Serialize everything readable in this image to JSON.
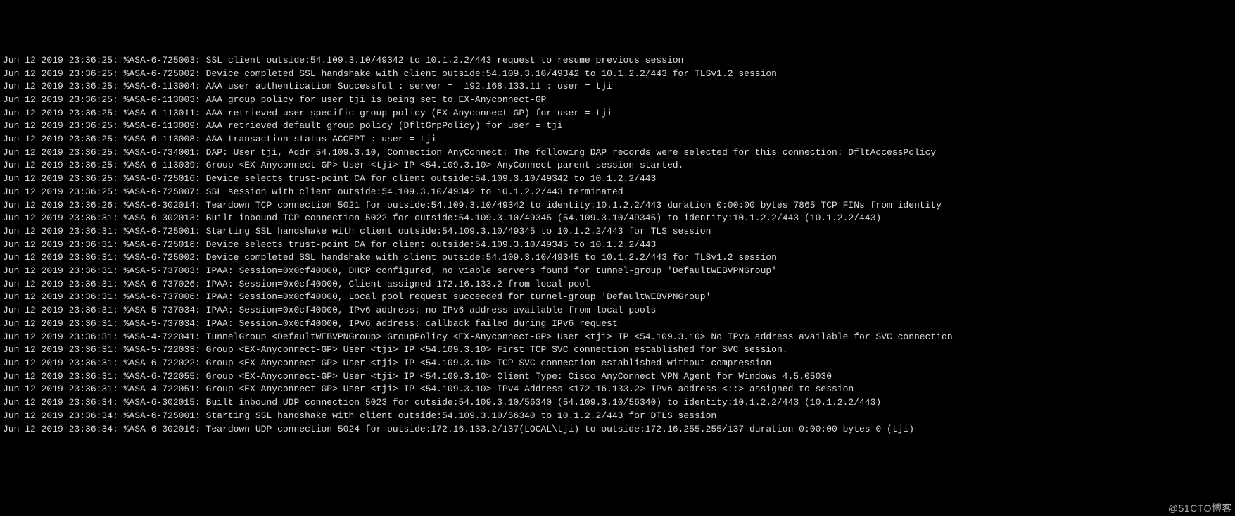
{
  "logs": [
    "Jun 12 2019 23:36:25: %ASA-6-725003: SSL client outside:54.109.3.10/49342 to 10.1.2.2/443 request to resume previous session",
    "Jun 12 2019 23:36:25: %ASA-6-725002: Device completed SSL handshake with client outside:54.109.3.10/49342 to 10.1.2.2/443 for TLSv1.2 session",
    "Jun 12 2019 23:36:25: %ASA-6-113004: AAA user authentication Successful : server =  192.168.133.11 : user = tji",
    "Jun 12 2019 23:36:25: %ASA-6-113003: AAA group policy for user tji is being set to EX-Anyconnect-GP",
    "Jun 12 2019 23:36:25: %ASA-6-113011: AAA retrieved user specific group policy (EX-Anyconnect-GP) for user = tji",
    "Jun 12 2019 23:36:25: %ASA-6-113009: AAA retrieved default group policy (DfltGrpPolicy) for user = tji",
    "Jun 12 2019 23:36:25: %ASA-6-113008: AAA transaction status ACCEPT : user = tji",
    "Jun 12 2019 23:36:25: %ASA-6-734001: DAP: User tji, Addr 54.109.3.10, Connection AnyConnect: The following DAP records were selected for this connection: DfltAccessPolicy",
    "Jun 12 2019 23:36:25: %ASA-6-113039: Group <EX-Anyconnect-GP> User <tji> IP <54.109.3.10> AnyConnect parent session started.",
    "Jun 12 2019 23:36:25: %ASA-6-725016: Device selects trust-point CA for client outside:54.109.3.10/49342 to 10.1.2.2/443",
    "Jun 12 2019 23:36:25: %ASA-6-725007: SSL session with client outside:54.109.3.10/49342 to 10.1.2.2/443 terminated",
    "Jun 12 2019 23:36:26: %ASA-6-302014: Teardown TCP connection 5021 for outside:54.109.3.10/49342 to identity:10.1.2.2/443 duration 0:00:00 bytes 7865 TCP FINs from identity",
    "Jun 12 2019 23:36:31: %ASA-6-302013: Built inbound TCP connection 5022 for outside:54.109.3.10/49345 (54.109.3.10/49345) to identity:10.1.2.2/443 (10.1.2.2/443)",
    "Jun 12 2019 23:36:31: %ASA-6-725001: Starting SSL handshake with client outside:54.109.3.10/49345 to 10.1.2.2/443 for TLS session",
    "Jun 12 2019 23:36:31: %ASA-6-725016: Device selects trust-point CA for client outside:54.109.3.10/49345 to 10.1.2.2/443",
    "Jun 12 2019 23:36:31: %ASA-6-725002: Device completed SSL handshake with client outside:54.109.3.10/49345 to 10.1.2.2/443 for TLSv1.2 session",
    "Jun 12 2019 23:36:31: %ASA-5-737003: IPAA: Session=0x0cf40000, DHCP configured, no viable servers found for tunnel-group 'DefaultWEBVPNGroup'",
    "Jun 12 2019 23:36:31: %ASA-6-737026: IPAA: Session=0x0cf40000, Client assigned 172.16.133.2 from local pool",
    "Jun 12 2019 23:36:31: %ASA-6-737006: IPAA: Session=0x0cf40000, Local pool request succeeded for tunnel-group 'DefaultWEBVPNGroup'",
    "Jun 12 2019 23:36:31: %ASA-5-737034: IPAA: Session=0x0cf40000, IPv6 address: no IPv6 address available from local pools",
    "Jun 12 2019 23:36:31: %ASA-5-737034: IPAA: Session=0x0cf40000, IPv6 address: callback failed during IPv6 request",
    "Jun 12 2019 23:36:31: %ASA-4-722041: TunnelGroup <DefaultWEBVPNGroup> GroupPolicy <EX-Anyconnect-GP> User <tji> IP <54.109.3.10> No IPv6 address available for SVC connection",
    "Jun 12 2019 23:36:31: %ASA-5-722033: Group <EX-Anyconnect-GP> User <tji> IP <54.109.3.10> First TCP SVC connection established for SVC session.",
    "Jun 12 2019 23:36:31: %ASA-6-722022: Group <EX-Anyconnect-GP> User <tji> IP <54.109.3.10> TCP SVC connection established without compression",
    "Jun 12 2019 23:36:31: %ASA-6-722055: Group <EX-Anyconnect-GP> User <tji> IP <54.109.3.10> Client Type: Cisco AnyConnect VPN Agent for Windows 4.5.05030",
    "Jun 12 2019 23:36:31: %ASA-4-722051: Group <EX-Anyconnect-GP> User <tji> IP <54.109.3.10> IPv4 Address <172.16.133.2> IPv6 address <::> assigned to session",
    "Jun 12 2019 23:36:34: %ASA-6-302015: Built inbound UDP connection 5023 for outside:54.109.3.10/56340 (54.109.3.10/56340) to identity:10.1.2.2/443 (10.1.2.2/443)",
    "Jun 12 2019 23:36:34: %ASA-6-725001: Starting SSL handshake with client outside:54.109.3.10/56340 to 10.1.2.2/443 for DTLS session",
    "Jun 12 2019 23:36:34: %ASA-6-302016: Teardown UDP connection 5024 for outside:172.16.133.2/137(LOCAL\\tji) to outside:172.16.255.255/137 duration 0:00:00 bytes 0 (tji)"
  ],
  "watermark": "@51CTO博客"
}
